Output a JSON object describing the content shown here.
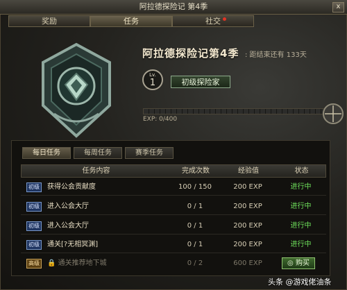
{
  "window": {
    "title": "阿拉德探险记 第4季",
    "close_label": "x"
  },
  "tabs": [
    {
      "label": "奖励",
      "active": false
    },
    {
      "label": "任务",
      "active": true
    },
    {
      "label": "社交",
      "active": false
    }
  ],
  "season": {
    "title": "阿拉德探险记第4季",
    "countdown": ": 距结束还有 133天",
    "level_prefix": "Lv.",
    "level": "1",
    "rank": "初级探险家",
    "exp_label": "EXP: 0/400",
    "exp_progress": 0
  },
  "subtabs": [
    {
      "label": "每日任务",
      "active": true
    },
    {
      "label": "每周任务",
      "active": false
    },
    {
      "label": "赛季任务",
      "active": false
    }
  ],
  "table": {
    "headers": [
      "任务内容",
      "完成次数",
      "经验值",
      "状态"
    ],
    "rows": [
      {
        "tag": "初级",
        "tag_color": "#1e3460",
        "name": "获得公会贡献度",
        "count": "100 / 150",
        "exp": "200 EXP",
        "status": "进行中"
      },
      {
        "tag": "初级",
        "tag_color": "#1e3460",
        "name": "进入公会大厅",
        "count": "0 / 1",
        "exp": "200 EXP",
        "status": "进行中"
      },
      {
        "tag": "初级",
        "tag_color": "#1e3460",
        "name": "进入公会大厅",
        "count": "0 / 1",
        "exp": "200 EXP",
        "status": "进行中"
      },
      {
        "tag": "初级",
        "tag_color": "#1e3460",
        "name": "通关[?无相冥渊]",
        "count": "0 / 1",
        "exp": "200 EXP",
        "status": "进行中"
      },
      {
        "tag": "高级",
        "tag_color": "#5a3f12",
        "name": "通关推荐地下城",
        "count": "0 / 2",
        "exp": "600 EXP",
        "status": "购买",
        "locked": true
      }
    ]
  },
  "icons": {
    "lock": "lock-icon",
    "coin": "coin-icon",
    "emblem": "season-emblem-icon"
  },
  "colors": {
    "status_active": "#6fe25c",
    "tag_basic": "#1e3460",
    "tag_advanced": "#5a3f12"
  },
  "watermark": "头条 @游戏佬油条"
}
